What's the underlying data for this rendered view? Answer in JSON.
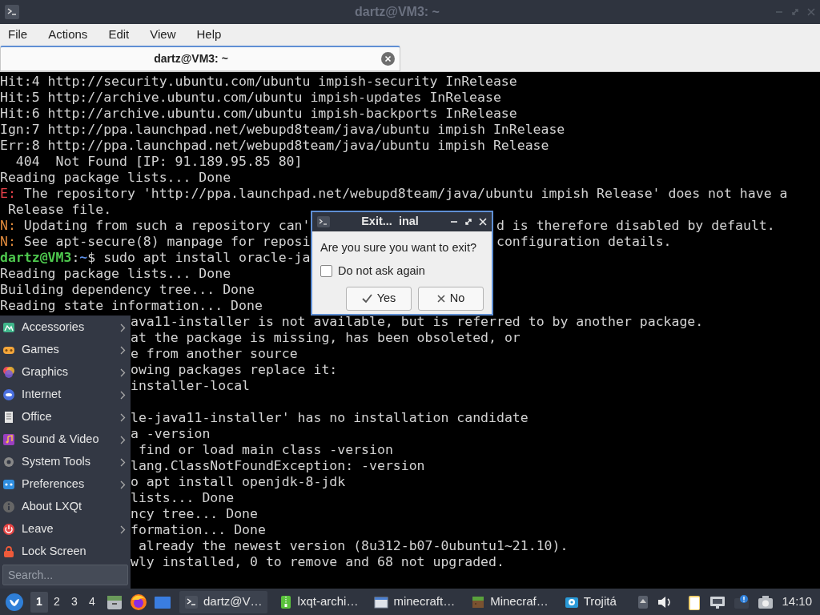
{
  "window": {
    "title": "dartz@VM3: ~"
  },
  "menubar": [
    "File",
    "Actions",
    "Edit",
    "View",
    "Help"
  ],
  "tabs": [
    {
      "label": "dartz@VM3: ~",
      "selected": true
    }
  ],
  "terminal": {
    "lines": [
      {
        "kind": "plain",
        "text": "Hit:4 http://security.ubuntu.com/ubuntu impish-security InRelease"
      },
      {
        "kind": "plain",
        "text": "Hit:5 http://archive.ubuntu.com/ubuntu impish-updates InRelease"
      },
      {
        "kind": "plain",
        "text": "Hit:6 http://archive.ubuntu.com/ubuntu impish-backports InRelease"
      },
      {
        "kind": "plain",
        "text": "Ign:7 http://ppa.launchpad.net/webupd8team/java/ubuntu impish InRelease"
      },
      {
        "kind": "plain",
        "text": "Err:8 http://ppa.launchpad.net/webupd8team/java/ubuntu impish Release"
      },
      {
        "kind": "plain",
        "text": "  404  Not Found [IP: 91.189.95.85 80]"
      },
      {
        "kind": "plain",
        "text": "Reading package lists... Done"
      },
      {
        "kind": "error",
        "prefix": "E:",
        "text": " The repository 'http://ppa.launchpad.net/webupd8team/java/ubuntu impish Release' does not have a"
      },
      {
        "kind": "plain",
        "text": " Release file."
      },
      {
        "kind": "note",
        "prefix": "N:",
        "text": " Updating from such a repository can'",
        "after_dialog": "d is therefore disabled by default."
      },
      {
        "kind": "note",
        "prefix": "N:",
        "text": " See apt-secure(8) manpage for reposi",
        "after_dialog": "configuration details."
      },
      {
        "kind": "prompt",
        "user": "dartz@VM3",
        "sep": ":",
        "path": "~",
        "text": "$ sudo apt install oracle-ja"
      },
      {
        "kind": "plain",
        "text": "Reading package lists... Done"
      },
      {
        "kind": "plain",
        "text": "Building dependency tree... Done"
      },
      {
        "kind": "plain",
        "text": "Reading state information... Done"
      },
      {
        "kind": "tail",
        "text": "ava11-installer is not available, but is referred to by another package."
      },
      {
        "kind": "tail",
        "text": "at the package is missing, has been obsoleted, or"
      },
      {
        "kind": "tail",
        "text": "e from another source"
      },
      {
        "kind": "tail",
        "text": "owing packages replace it:"
      },
      {
        "kind": "tail",
        "text": "installer-local"
      },
      {
        "kind": "blank"
      },
      {
        "kind": "tail",
        "text": "le-java11-installer' has no installation candidate"
      },
      {
        "kind": "tail",
        "text": "a -version"
      },
      {
        "kind": "tail",
        "text": " find or load main class -version"
      },
      {
        "kind": "tail",
        "text": "lang.ClassNotFoundException: -version"
      },
      {
        "kind": "tail",
        "text": "o apt install openjdk-8-jdk"
      },
      {
        "kind": "tail",
        "text": "lists... Done"
      },
      {
        "kind": "tail",
        "text": "ncy tree... Done"
      },
      {
        "kind": "tail",
        "text": "formation... Done"
      },
      {
        "kind": "tail",
        "text": " already the newest version (8u312-b07-0ubuntu1~21.10)."
      },
      {
        "kind": "tail",
        "text": "wly installed, 0 to remove and 68 not upgraded."
      }
    ]
  },
  "app_menu": {
    "items": [
      {
        "label": "Accessories",
        "submenu": true
      },
      {
        "label": "Games",
        "submenu": true
      },
      {
        "label": "Graphics",
        "submenu": true
      },
      {
        "label": "Internet",
        "submenu": true
      },
      {
        "label": "Office",
        "submenu": true
      },
      {
        "label": "Sound & Video",
        "submenu": true
      },
      {
        "label": "System Tools",
        "submenu": true
      },
      {
        "label": "Preferences",
        "submenu": true
      },
      {
        "label": "About LXQt",
        "submenu": false
      },
      {
        "label": "Leave",
        "submenu": true
      },
      {
        "label": "Lock Screen",
        "submenu": false
      }
    ],
    "search": {
      "placeholder": "Search..."
    }
  },
  "dialog": {
    "title": "Exit...  inal",
    "message": "Are you sure you want to exit?",
    "checkbox": {
      "label": "Do not ask again",
      "checked": false
    },
    "buttons": [
      {
        "kind": "yes",
        "label": "Yes"
      },
      {
        "kind": "no",
        "label": "No"
      }
    ]
  },
  "taskbar": {
    "desktops": [
      {
        "label": "1",
        "selected": true
      },
      {
        "label": "2",
        "selected": false
      },
      {
        "label": "3",
        "selected": false
      },
      {
        "label": "4",
        "selected": false
      }
    ],
    "tasks": [
      {
        "label": "dartz@V…",
        "selected": true
      },
      {
        "label": "lxqt-archi…",
        "selected": false
      },
      {
        "label": "minecraft…",
        "selected": false
      },
      {
        "label": "Minecraf…",
        "selected": false
      },
      {
        "label": "Trojitá",
        "selected": false
      }
    ],
    "clock": "14:10"
  }
}
